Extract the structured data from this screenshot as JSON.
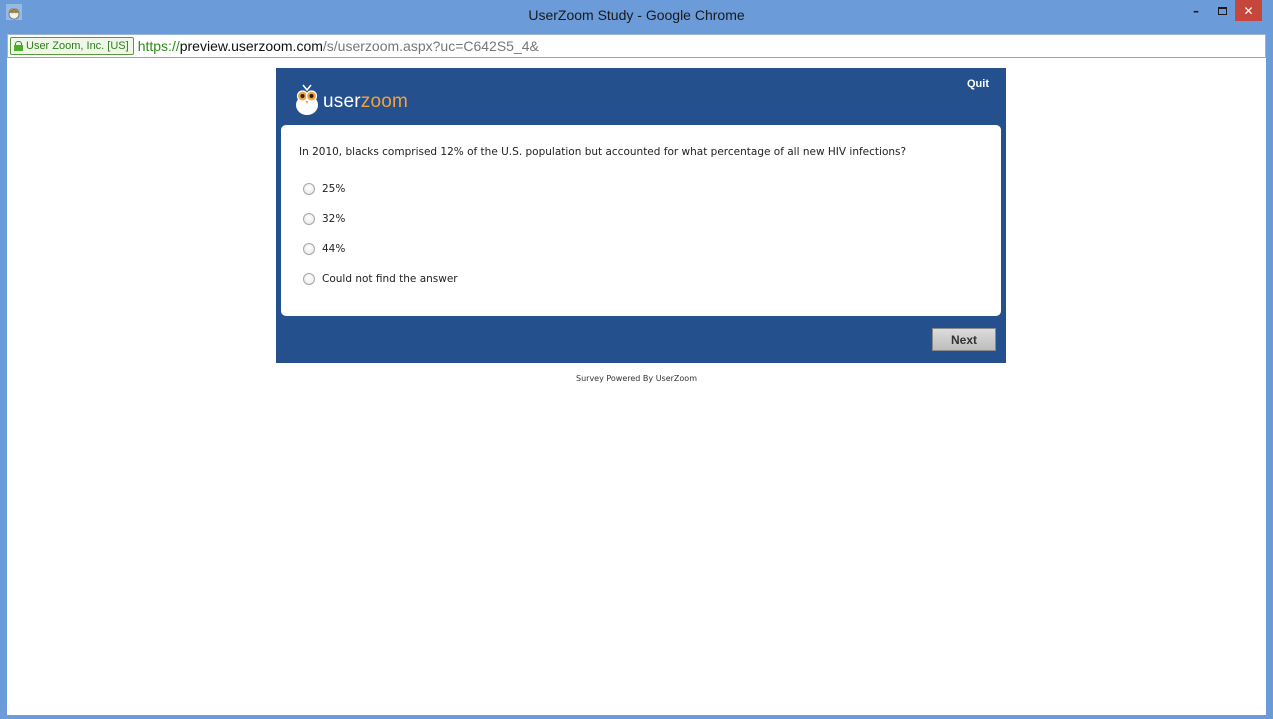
{
  "window": {
    "title": "UserZoom Study - Google Chrome",
    "app_icon": "userzoom-owl-icon",
    "controls": {
      "minimize_icon": "–",
      "maximize_icon": "maximize-icon",
      "close_icon": "✕"
    }
  },
  "address_bar": {
    "ev_label": "User Zoom, Inc. [US]",
    "url_scheme": "https://",
    "url_host": "preview.userzoom.com",
    "url_path": "/s/userzoom.aspx?uc=C642S5_4&"
  },
  "survey": {
    "brand_user": "user",
    "brand_zoom": "zoom",
    "brand_colors": {
      "panel": "#24508e",
      "accent": "#f4a23a"
    },
    "quit_label": "Quit",
    "question": "In 2010, blacks comprised 12% of the U.S. population but accounted for what percentage of all new HIV infections?",
    "options": [
      "25%",
      "32%",
      "44%",
      "Could not find the answer"
    ],
    "next_label": "Next"
  },
  "footer": {
    "powered_by": "Survey Powered By UserZoom"
  }
}
